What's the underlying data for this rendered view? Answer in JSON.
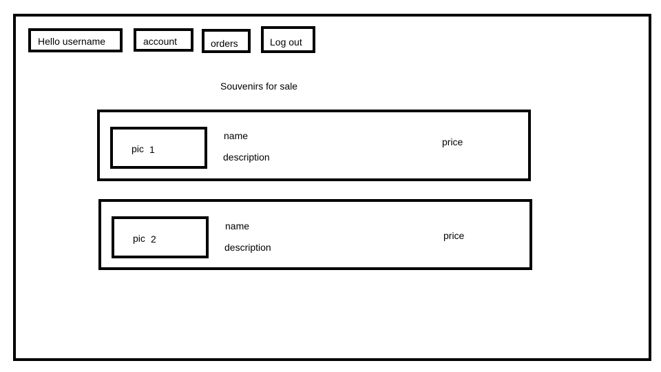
{
  "nav": {
    "hello": "Hello username",
    "account": "account",
    "orders": "orders",
    "logout": "Log out"
  },
  "page": {
    "title": "Souvenirs for sale"
  },
  "products": [
    {
      "pic_label": "pic",
      "pic_number": "1",
      "name": "name",
      "description": "description",
      "price": "price"
    },
    {
      "pic_label": "pic",
      "pic_number": "2",
      "name": "name",
      "description": "description",
      "price": "price"
    }
  ]
}
